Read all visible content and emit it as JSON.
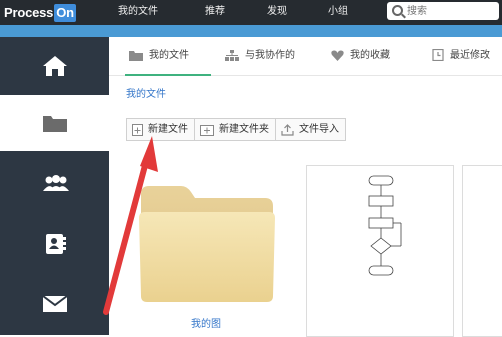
{
  "app": {
    "logo_text": "Process",
    "logo_badge": "On"
  },
  "topnav": {
    "items": [
      "我的文件",
      "推荐",
      "发现",
      "小组"
    ]
  },
  "search": {
    "placeholder": "搜索"
  },
  "sidebar": {
    "items": [
      {
        "icon": "home-icon"
      },
      {
        "icon": "folder-icon",
        "active": true
      },
      {
        "icon": "group-icon"
      },
      {
        "icon": "contacts-icon"
      },
      {
        "icon": "mail-icon"
      }
    ]
  },
  "tabs": [
    {
      "label": "我的文件",
      "icon": "folder-icon",
      "active": true
    },
    {
      "label": "与我协作的",
      "icon": "org-chart-icon"
    },
    {
      "label": "我的收藏",
      "icon": "heart-icon"
    },
    {
      "label": "最近修改",
      "icon": "clock-icon"
    }
  ],
  "breadcrumb": "我的文件",
  "toolbar": {
    "new_file": "新建文件",
    "new_folder": "新建文件夹",
    "import_file": "文件导入"
  },
  "folder": {
    "label": "我的图"
  },
  "colors": {
    "topbar": "#262b30",
    "accent_blue": "#4a9ad4",
    "sidebar": "#2d3743",
    "active_tab": "#3fb27f",
    "link": "#3476c9",
    "annotation_arrow": "#e23a3a"
  }
}
